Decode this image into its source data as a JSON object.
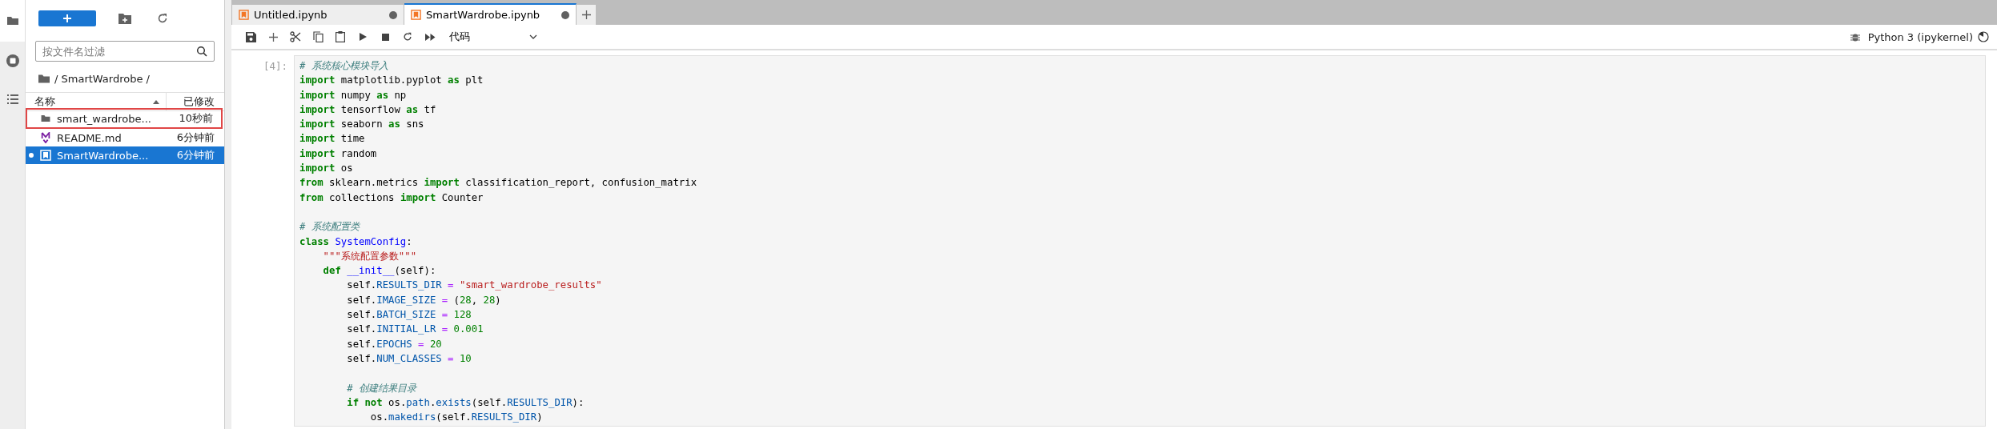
{
  "activity_bar": {
    "items": [
      {
        "kind": "files",
        "selected": true
      },
      {
        "kind": "running",
        "selected": false
      },
      {
        "kind": "toc",
        "selected": false
      }
    ]
  },
  "file_browser": {
    "filter": {
      "placeholder": "按文件名过滤"
    },
    "breadcrumb": "/ SmartWardrobe /",
    "columns": {
      "name": "名称",
      "modified": "已修改"
    },
    "items": [
      {
        "kind": "folder",
        "name": "smart_wardrobe...",
        "modified": "10秒前",
        "selected": false,
        "running": false,
        "annotated": true
      },
      {
        "kind": "markdown",
        "name": "README.md",
        "modified": "6分钟前",
        "selected": false,
        "running": false,
        "annotated": false
      },
      {
        "kind": "notebook",
        "name": "SmartWardrobe...",
        "modified": "6分钟前",
        "selected": true,
        "running": true,
        "annotated": false
      }
    ]
  },
  "tabs": [
    {
      "label": "Untitled.ipynb",
      "selected": false,
      "unsaved": true
    },
    {
      "label": "SmartWardrobe.ipynb",
      "selected": true,
      "unsaved": true
    }
  ],
  "toolbar": {
    "cell_type": "代码",
    "kernel": "Python 3 (ipykernel)"
  },
  "cell": {
    "prompt": "[4]:",
    "lines": [
      {
        "kind": "code",
        "tokens": [
          {
            "kind": "comment",
            "text": "# 系统核心模块导入"
          }
        ]
      },
      {
        "kind": "code",
        "tokens": [
          {
            "kind": "kw",
            "text": "import"
          },
          {
            "kind": "plain",
            "text": " matplotlib.pyplot "
          },
          {
            "kind": "kw",
            "text": "as"
          },
          {
            "kind": "plain",
            "text": " plt"
          }
        ]
      },
      {
        "kind": "code",
        "tokens": [
          {
            "kind": "kw",
            "text": "import"
          },
          {
            "kind": "plain",
            "text": " numpy "
          },
          {
            "kind": "kw",
            "text": "as"
          },
          {
            "kind": "plain",
            "text": " np"
          }
        ]
      },
      {
        "kind": "code",
        "tokens": [
          {
            "kind": "kw",
            "text": "import"
          },
          {
            "kind": "plain",
            "text": " tensorflow "
          },
          {
            "kind": "kw",
            "text": "as"
          },
          {
            "kind": "plain",
            "text": " tf"
          }
        ]
      },
      {
        "kind": "code",
        "tokens": [
          {
            "kind": "kw",
            "text": "import"
          },
          {
            "kind": "plain",
            "text": " seaborn "
          },
          {
            "kind": "kw",
            "text": "as"
          },
          {
            "kind": "plain",
            "text": " sns"
          }
        ]
      },
      {
        "kind": "code",
        "tokens": [
          {
            "kind": "kw",
            "text": "import"
          },
          {
            "kind": "plain",
            "text": " time"
          }
        ]
      },
      {
        "kind": "code",
        "tokens": [
          {
            "kind": "kw",
            "text": "import"
          },
          {
            "kind": "plain",
            "text": " random"
          }
        ]
      },
      {
        "kind": "code",
        "tokens": [
          {
            "kind": "kw",
            "text": "import"
          },
          {
            "kind": "plain",
            "text": " os"
          }
        ]
      },
      {
        "kind": "code",
        "tokens": [
          {
            "kind": "kw",
            "text": "from"
          },
          {
            "kind": "plain",
            "text": " sklearn.metrics "
          },
          {
            "kind": "kw",
            "text": "import"
          },
          {
            "kind": "plain",
            "text": " classification_report, confusion_matrix"
          }
        ]
      },
      {
        "kind": "code",
        "tokens": [
          {
            "kind": "kw",
            "text": "from"
          },
          {
            "kind": "plain",
            "text": " collections "
          },
          {
            "kind": "kw",
            "text": "import"
          },
          {
            "kind": "plain",
            "text": " Counter"
          }
        ]
      },
      {
        "kind": "blank"
      },
      {
        "kind": "code",
        "tokens": [
          {
            "kind": "comment",
            "text": "# 系统配置类"
          }
        ]
      },
      {
        "kind": "code",
        "tokens": [
          {
            "kind": "kw",
            "text": "class"
          },
          {
            "kind": "def",
            "text": " SystemConfig"
          },
          {
            "kind": "plain",
            "text": ":"
          }
        ]
      },
      {
        "kind": "code",
        "tokens": [
          {
            "kind": "str",
            "text": "    \"\"\"系统配置参数\"\"\""
          }
        ]
      },
      {
        "kind": "code",
        "tokens": [
          {
            "kind": "kw",
            "text": "    def"
          },
          {
            "kind": "def",
            "text": " __init__"
          },
          {
            "kind": "plain",
            "text": "(self):"
          }
        ]
      },
      {
        "kind": "code",
        "tokens": [
          {
            "kind": "plain",
            "text": "        self."
          },
          {
            "kind": "attr",
            "text": "RESULTS_DIR"
          },
          {
            "kind": "op",
            "text": " = "
          },
          {
            "kind": "str",
            "text": "\"smart_wardrobe_results\""
          }
        ]
      },
      {
        "kind": "code",
        "tokens": [
          {
            "kind": "plain",
            "text": "        self."
          },
          {
            "kind": "attr",
            "text": "IMAGE_SIZE"
          },
          {
            "kind": "op",
            "text": " = "
          },
          {
            "kind": "plain",
            "text": "("
          },
          {
            "kind": "num",
            "text": "28"
          },
          {
            "kind": "plain",
            "text": ", "
          },
          {
            "kind": "num",
            "text": "28"
          },
          {
            "kind": "plain",
            "text": ")"
          }
        ]
      },
      {
        "kind": "code",
        "tokens": [
          {
            "kind": "plain",
            "text": "        self."
          },
          {
            "kind": "attr",
            "text": "BATCH_SIZE"
          },
          {
            "kind": "op",
            "text": " = "
          },
          {
            "kind": "num",
            "text": "128"
          }
        ]
      },
      {
        "kind": "code",
        "tokens": [
          {
            "kind": "plain",
            "text": "        self."
          },
          {
            "kind": "attr",
            "text": "INITIAL_LR"
          },
          {
            "kind": "op",
            "text": " = "
          },
          {
            "kind": "num",
            "text": "0.001"
          }
        ]
      },
      {
        "kind": "code",
        "tokens": [
          {
            "kind": "plain",
            "text": "        self."
          },
          {
            "kind": "attr",
            "text": "EPOCHS"
          },
          {
            "kind": "op",
            "text": " = "
          },
          {
            "kind": "num",
            "text": "20"
          }
        ]
      },
      {
        "kind": "code",
        "tokens": [
          {
            "kind": "plain",
            "text": "        self."
          },
          {
            "kind": "attr",
            "text": "NUM_CLASSES"
          },
          {
            "kind": "op",
            "text": " = "
          },
          {
            "kind": "num",
            "text": "10"
          }
        ]
      },
      {
        "kind": "blank"
      },
      {
        "kind": "code",
        "tokens": [
          {
            "kind": "comment",
            "text": "        # 创建结果目录"
          }
        ]
      },
      {
        "kind": "code",
        "tokens": [
          {
            "kind": "kw",
            "text": "        if"
          },
          {
            "kind": "kw",
            "text": " not"
          },
          {
            "kind": "plain",
            "text": " os."
          },
          {
            "kind": "attr",
            "text": "path"
          },
          {
            "kind": "plain",
            "text": "."
          },
          {
            "kind": "attr",
            "text": "exists"
          },
          {
            "kind": "plain",
            "text": "(self."
          },
          {
            "kind": "attr",
            "text": "RESULTS_DIR"
          },
          {
            "kind": "plain",
            "text": "):"
          }
        ]
      },
      {
        "kind": "code",
        "tokens": [
          {
            "kind": "plain",
            "text": "            os."
          },
          {
            "kind": "attr",
            "text": "makedirs"
          },
          {
            "kind": "plain",
            "text": "(self."
          },
          {
            "kind": "attr",
            "text": "RESULTS_DIR"
          },
          {
            "kind": "plain",
            "text": ")"
          }
        ]
      }
    ]
  }
}
